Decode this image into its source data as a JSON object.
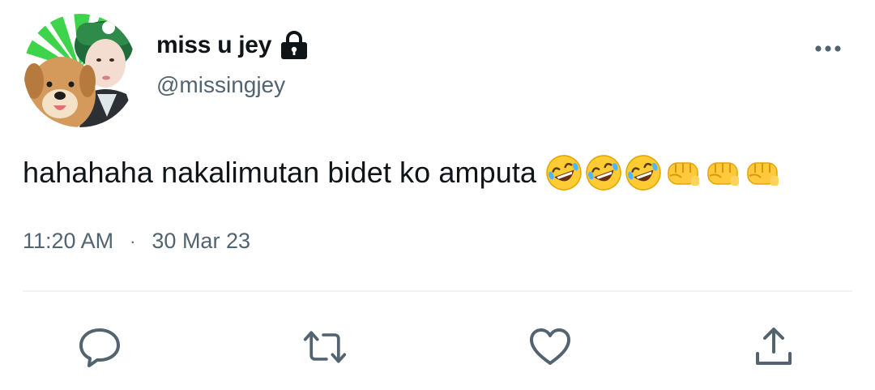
{
  "tweet": {
    "display_name": "miss u jey",
    "handle": "@missingjey",
    "text": "hahahaha nakalimutan bidet ko amputa",
    "emojis": [
      "rolling-on-floor-laughing",
      "rolling-on-floor-laughing",
      "rolling-on-floor-laughing",
      "oncoming-fist",
      "oncoming-fist",
      "oncoming-fist"
    ],
    "time": "11:20 AM",
    "separator": "·",
    "date": "30 Mar 23"
  },
  "icons": {
    "lock": "lock-icon",
    "more": "more-horizontal-icon",
    "reply": "reply-icon",
    "retweet": "retweet-icon",
    "like": "heart-icon",
    "share": "share-icon"
  },
  "colors": {
    "text_primary": "#0f1419",
    "text_secondary": "#536471",
    "divider": "#eff3f4",
    "avatar_accent": "#3dd34a"
  }
}
